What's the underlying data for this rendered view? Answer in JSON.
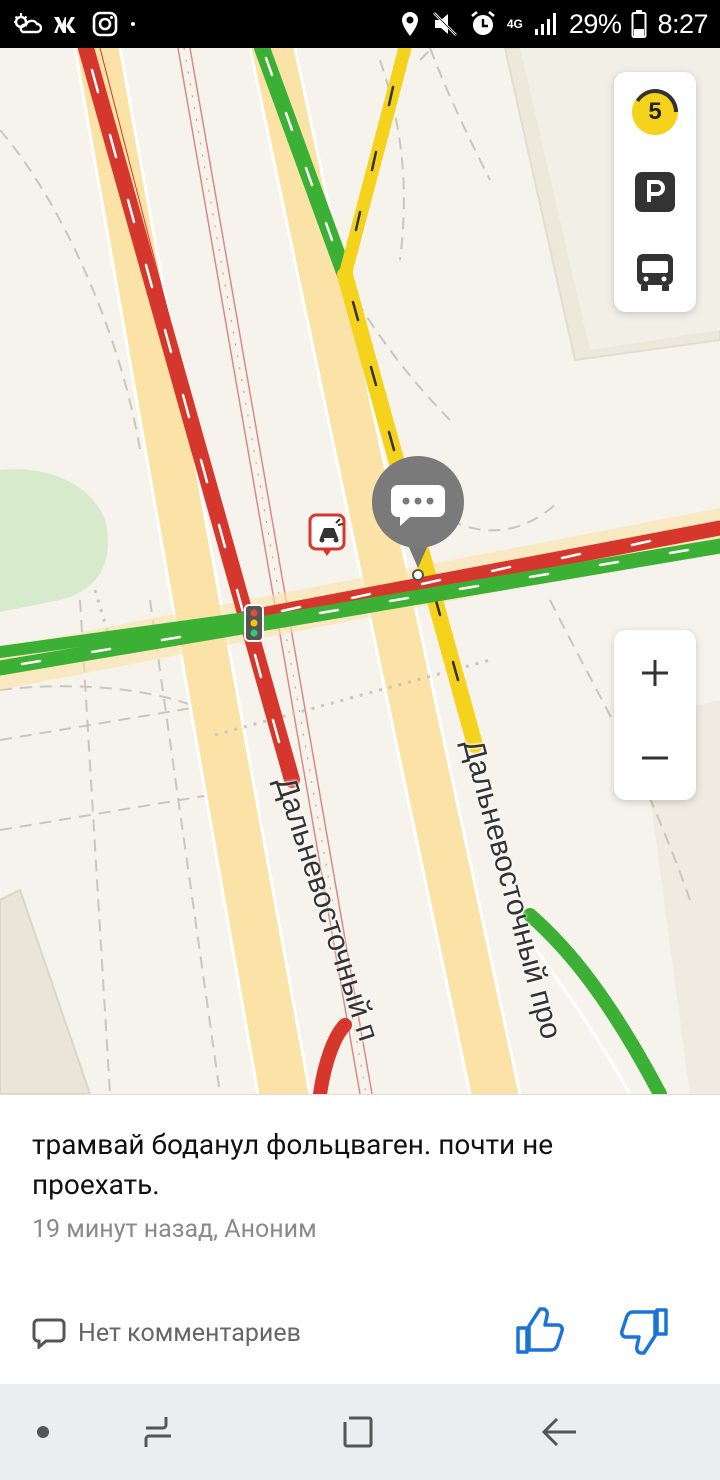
{
  "status_bar": {
    "network": "4G",
    "battery_percent": "29%",
    "time": "8:27",
    "left_icons": [
      "weather-icon",
      "vk-icon",
      "instagram-icon",
      "dot-icon"
    ],
    "right_icons": [
      "location-icon",
      "mute-icon",
      "alarm-icon",
      "signal-icon",
      "battery-icon"
    ]
  },
  "map": {
    "road_labels": [
      "Дальневосточный п",
      "Дальневосточный про"
    ],
    "traffic_level": "5",
    "colors": {
      "background": "#f5f3ec",
      "road": "#fbe3a8",
      "traffic_red": "#d6372c",
      "traffic_green": "#3cb034",
      "traffic_yellow": "#f5d21c",
      "tram_line": "#d98a86"
    },
    "layer_buttons": [
      "traffic-level-icon",
      "parking-icon",
      "bus-icon"
    ],
    "zoom_in_label": "+",
    "zoom_out_label": "−"
  },
  "card": {
    "message": "трамвай боданул фольцваген. почти не проехать.",
    "meta": "19 минут назад, Аноним",
    "comments_label": "Нет комментариев",
    "accent_color": "#1a73d9"
  },
  "nav_bar": {
    "buttons": [
      "dot-button",
      "recent-apps-button",
      "home-button",
      "back-button"
    ]
  }
}
